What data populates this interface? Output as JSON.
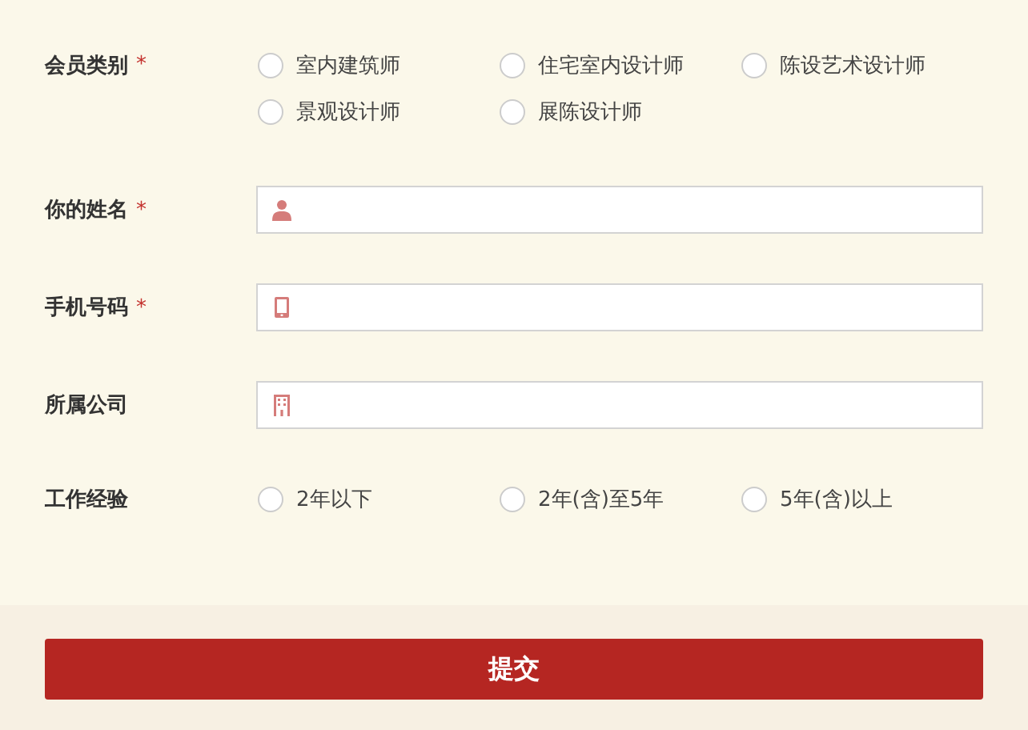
{
  "fields": [
    {
      "kind": "radio",
      "label": "会员类别",
      "required_mark": "*",
      "options": [
        {
          "label": "室内建筑师",
          "selected": false
        },
        {
          "label": "住宅室内设计师",
          "selected": false
        },
        {
          "label": "陈设艺术设计师",
          "selected": false
        },
        {
          "label": "景观设计师",
          "selected": false
        },
        {
          "label": "展陈设计师",
          "selected": false
        }
      ]
    },
    {
      "kind": "input",
      "label": "你的姓名",
      "required_mark": "*"
    },
    {
      "kind": "input",
      "label": "手机号码",
      "required_mark": "*"
    },
    {
      "kind": "input",
      "label": "所属公司"
    },
    {
      "kind": "radio",
      "label": "工作经验",
      "options": [
        {
          "label": "2年以下",
          "selected": false
        },
        {
          "label": "2年(含)至5年",
          "selected": false
        },
        {
          "label": "5年(含)以上",
          "selected": false
        }
      ]
    }
  ],
  "submit": "提交"
}
